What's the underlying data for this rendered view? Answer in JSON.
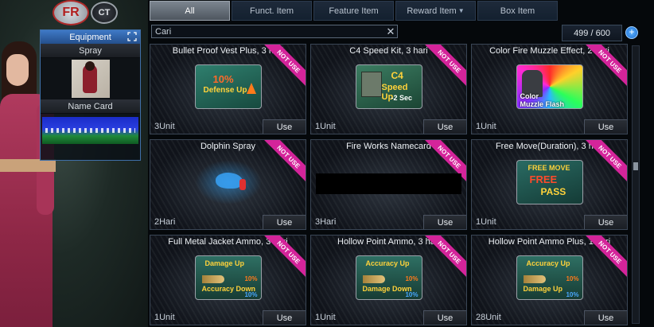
{
  "logo": {
    "left": "FR",
    "right": "CT"
  },
  "equipment": {
    "title": "Equipment",
    "spray_label": "Spray",
    "namecard_label": "Name Card"
  },
  "tabs": [
    {
      "label": "All",
      "active": true
    },
    {
      "label": "Funct. Item",
      "active": false
    },
    {
      "label": "Feature Item",
      "active": false
    },
    {
      "label": "Reward Item",
      "active": false
    },
    {
      "label": "Box Item",
      "active": false
    }
  ],
  "search": {
    "value": "Cari"
  },
  "counter": "499 / 600",
  "ribbon": "NOT USE",
  "use_label": "Use",
  "items": [
    {
      "title": "Bullet Proof Vest Plus, 3 hari",
      "unit": "3Unit",
      "icon": "vest-icon",
      "icon_text": [
        "10%",
        "Defense Up"
      ]
    },
    {
      "title": "C4 Speed Kit, 3 hari",
      "unit": "1Unit",
      "icon": "c4-kit-icon",
      "icon_text": [
        "C4",
        "Speed Up",
        "-2 Sec"
      ]
    },
    {
      "title": "Color Fire Muzzle Effect, 2 hari",
      "unit": "1Unit",
      "icon": "muzzle-effect-icon",
      "icon_text": [
        "Color",
        "Muzzle Flash"
      ]
    },
    {
      "title": "Dolphin Spray",
      "unit": "2Hari",
      "icon": "dolphin-spray-icon",
      "icon_text": []
    },
    {
      "title": "Fire Works Namecard",
      "unit": "3Hari",
      "icon": "namecard-icon",
      "icon_text": []
    },
    {
      "title": "Free Move(Duration), 3 hari",
      "unit": "1Unit",
      "icon": "free-move-icon",
      "icon_text": [
        "FREE MOVE",
        "FREE",
        "PASS"
      ]
    },
    {
      "title": "Full Metal Jacket Ammo, 3 hari",
      "unit": "1Unit",
      "icon": "ammo-icon",
      "icon_text": [
        "Damage Up",
        "Accuracy Down",
        "10%",
        "10%"
      ]
    },
    {
      "title": "Hollow Point Ammo, 3 hari",
      "unit": "1Unit",
      "icon": "ammo-icon",
      "icon_text": [
        "Accuracy Up",
        "Damage Down",
        "10%",
        "10%"
      ]
    },
    {
      "title": "Hollow Point Ammo Plus, 1 hari",
      "unit": "28Unit",
      "icon": "ammo-icon",
      "icon_text": [
        "Accuracy Up",
        "Damage Up",
        "10%",
        "10%"
      ]
    }
  ]
}
